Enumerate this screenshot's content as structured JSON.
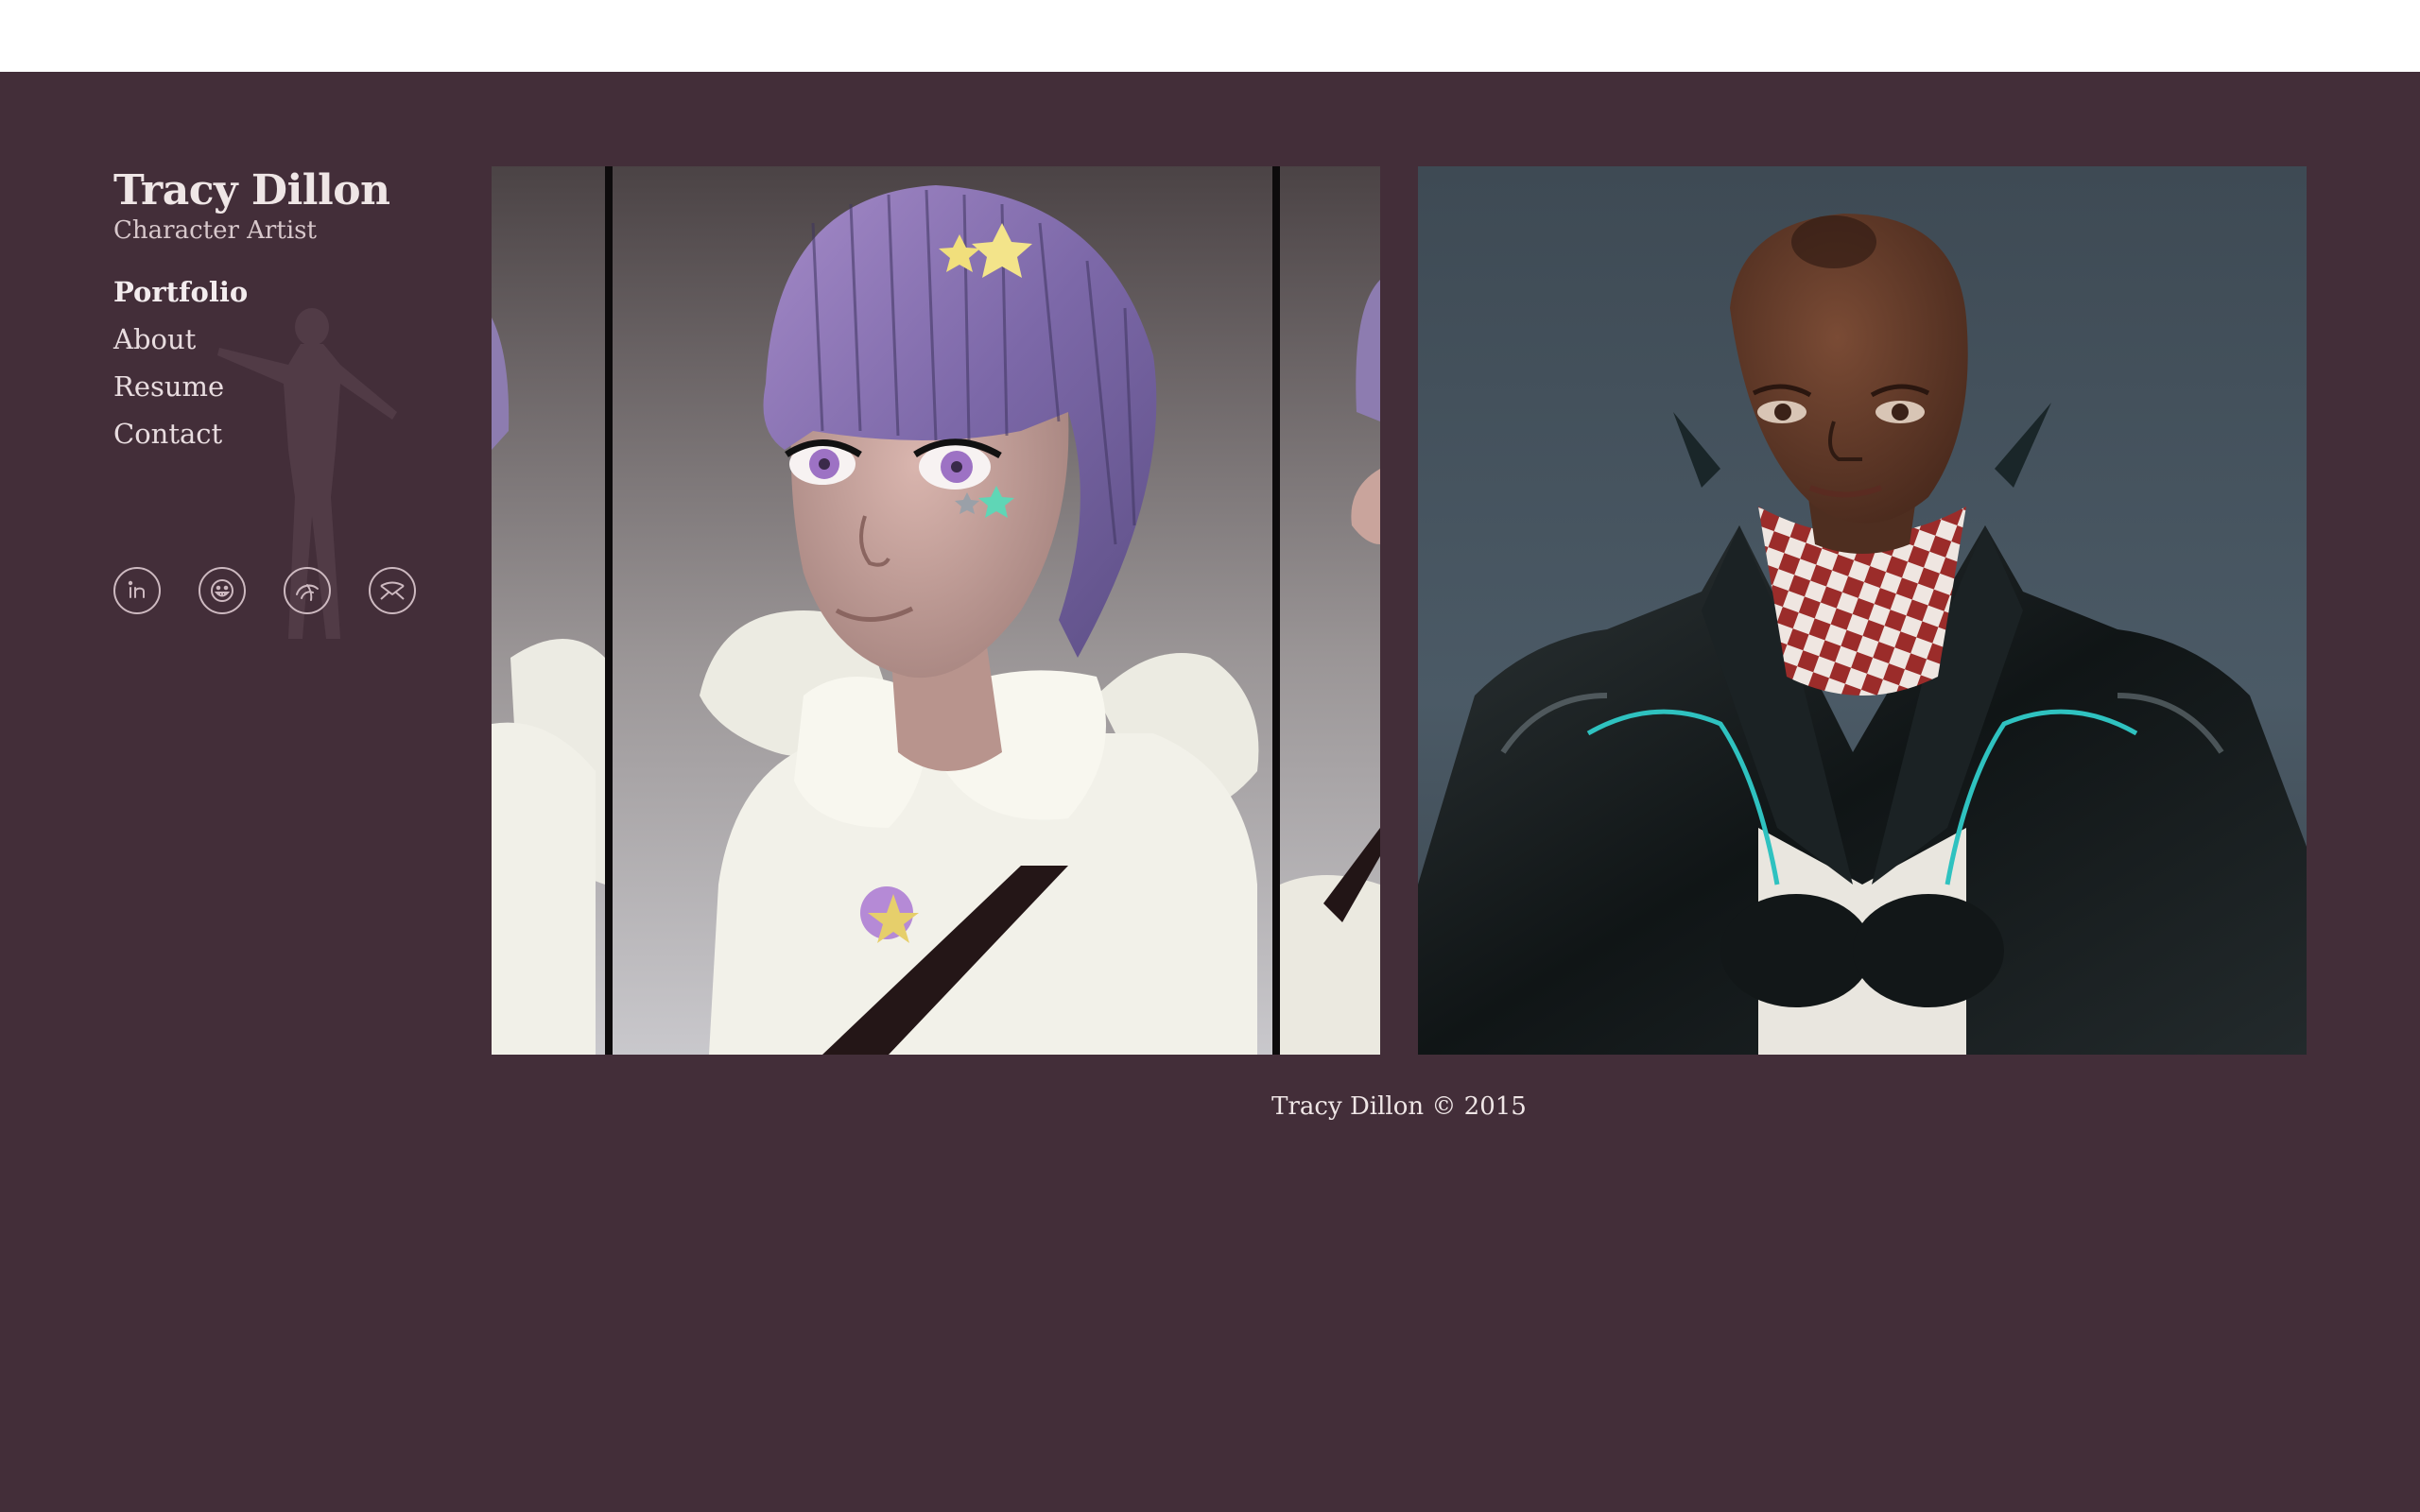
{
  "site": {
    "title": "Tracy Dillon",
    "subtitle": "Character Artist"
  },
  "nav": [
    {
      "label": "Portfolio",
      "active": true
    },
    {
      "label": "About",
      "active": false
    },
    {
      "label": "Resume",
      "active": false
    },
    {
      "label": "Contact",
      "active": false
    }
  ],
  "social_icons": [
    "linkedin-icon",
    "smiley-icon",
    "dribbble-icon",
    "email-icon"
  ],
  "gallery": [
    {
      "icon": "purple-hair-character-render"
    },
    {
      "icon": "leather-jacket-character-render"
    }
  ],
  "footer": {
    "text": "Tracy Dillon © 2015"
  },
  "colors": {
    "page_bg": "#432e39",
    "text": "#efe6e6",
    "icon_stroke": "#cdb9c0"
  }
}
